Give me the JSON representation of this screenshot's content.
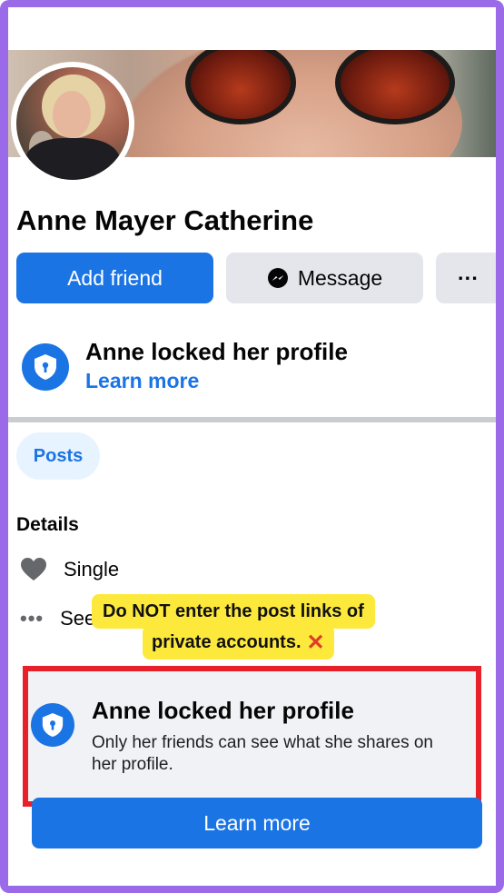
{
  "profile": {
    "name": "Anne Mayer Catherine"
  },
  "actions": {
    "add_friend": "Add friend",
    "message": "Message",
    "more": "···"
  },
  "lock_notice": {
    "title": "Anne locked her profile",
    "link": "Learn more"
  },
  "tabs": {
    "posts": "Posts"
  },
  "details": {
    "heading": "Details",
    "relationship": "Single",
    "see_more": "See"
  },
  "annotation": {
    "line1": "Do NOT enter the post links of",
    "line2": "private accounts.",
    "mark": "✕"
  },
  "lock_card": {
    "title": "Anne locked her profile",
    "description": "Only her friends can see what she shares on her profile.",
    "button": "Learn more"
  },
  "colors": {
    "primary": "#1b74e4",
    "highlight_border": "#e8202a",
    "callout": "#fde93c",
    "frame": "#9b6ae8"
  },
  "icons": {
    "shield": "shield-lock-icon",
    "messenger": "messenger-icon",
    "heart": "heart-icon",
    "more": "more-dots-icon"
  }
}
